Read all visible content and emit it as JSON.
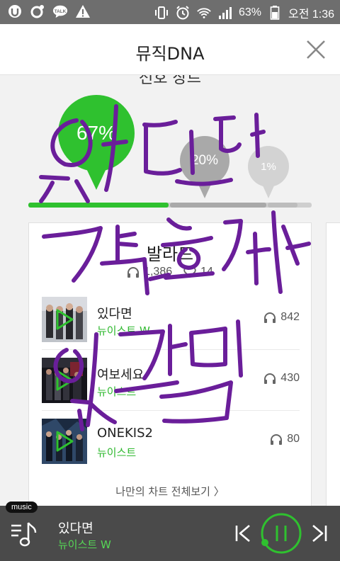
{
  "status_bar": {
    "battery": "63%",
    "time": "오전 1:36"
  },
  "header": {
    "title": "뮤직DNA"
  },
  "section": {
    "partial_title": "선호 장르"
  },
  "genre_bubbles": [
    {
      "percent": "67%",
      "share": 0.67,
      "color": "#2fc12f"
    },
    {
      "percent": "20%",
      "share": 0.2,
      "color": "#a9a9a9"
    },
    {
      "percent": "1%",
      "share": 0.01,
      "color": "#d3d3d3"
    }
  ],
  "genre_card": {
    "name": "발라드",
    "listens": "1,386",
    "likes": "14",
    "tracks": [
      {
        "title": "있다면",
        "artist": "뉴이스트 W",
        "plays": "842"
      },
      {
        "title": "여보세요",
        "artist": "뉴이스트",
        "plays": "430"
      },
      {
        "title": "ONEKIS2",
        "artist": "뉴이스트",
        "plays": "80"
      }
    ],
    "more_label": "나만의 차트 전체보기 〉"
  },
  "player": {
    "tag": "music",
    "title": "있다면",
    "artist": "뉴이스트 W"
  },
  "colors": {
    "accent": "#2fc12f",
    "scribble": "#6a1e9a"
  }
}
